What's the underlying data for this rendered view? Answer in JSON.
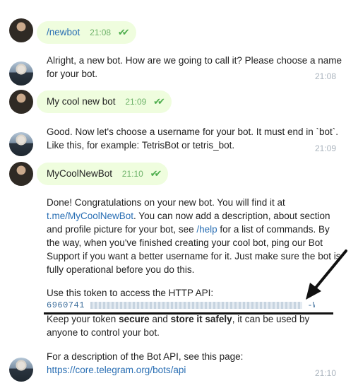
{
  "messages": {
    "m1": {
      "text": "/newbot",
      "time": "21:08",
      "checks": "✔✔"
    },
    "m2": {
      "text": "Alright, a new bot. How are we going to call it? Please choose a name for your bot.",
      "time": "21:08"
    },
    "m3": {
      "text": "My cool new bot",
      "time": "21:09",
      "checks": "✔✔"
    },
    "m4": {
      "text": "Good. Now let's choose a username for your bot. It must end in `bot`. Like this, for example: TetrisBot or tetris_bot.",
      "time": "21:09"
    },
    "m5": {
      "text": "MyCoolNewBot",
      "time": "21:10",
      "checks": "✔✔"
    },
    "m6": {
      "p1_a": "Done! Congratulations on your new bot. You will find it at ",
      "p1_link": "t.me/MyCoolNewBot",
      "p1_b": ". You can now add a description, about section and profile picture for your bot, see ",
      "p1_link2": "/help",
      "p1_c": " for a list of commands. By the way, when you've finished creating your cool bot, ping our Bot Support if you want a better username for it. Just make sure the bot is fully operational before you do this.",
      "token_label": "Use this token to access the HTTP API:",
      "token_start": "6960741",
      "token_end": "-W8",
      "keep_a": "Keep your token ",
      "keep_secure": "secure",
      "keep_b": " and ",
      "keep_store": "store it safely",
      "keep_c": ", it can be used by anyone to control your bot.",
      "api_text": "For a description of the Bot API, see this page:",
      "api_link": "https://core.telegram.org/bots/api",
      "time": "21:10"
    }
  }
}
